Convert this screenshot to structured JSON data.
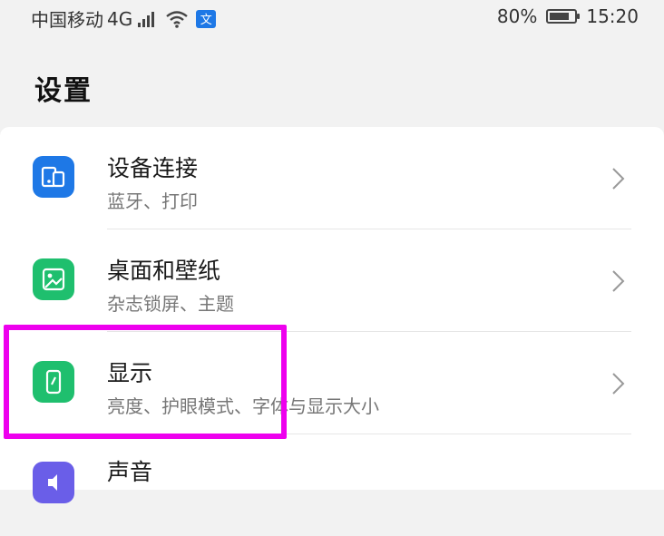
{
  "status_bar": {
    "carrier": "中国移动",
    "network": "4G",
    "battery_level": "80%",
    "battery_fraction": 0.8,
    "time": "15:20"
  },
  "header": {
    "title": "设置"
  },
  "settings_items": [
    {
      "title": "设备连接",
      "subtitle": "蓝牙、打印",
      "icon": "device-connection-icon",
      "color": "#1e78e6"
    },
    {
      "title": "桌面和壁纸",
      "subtitle": "杂志锁屏、主题",
      "icon": "wallpaper-icon",
      "color": "#1fbf6e"
    },
    {
      "title": "显示",
      "subtitle": "亮度、护眼模式、字体与显示大小",
      "icon": "display-icon",
      "color": "#1fbf6e"
    },
    {
      "title": "声音",
      "subtitle": "",
      "icon": "sound-icon",
      "color": "#6a5ee8"
    }
  ],
  "highlight_color": "#ee00ee"
}
